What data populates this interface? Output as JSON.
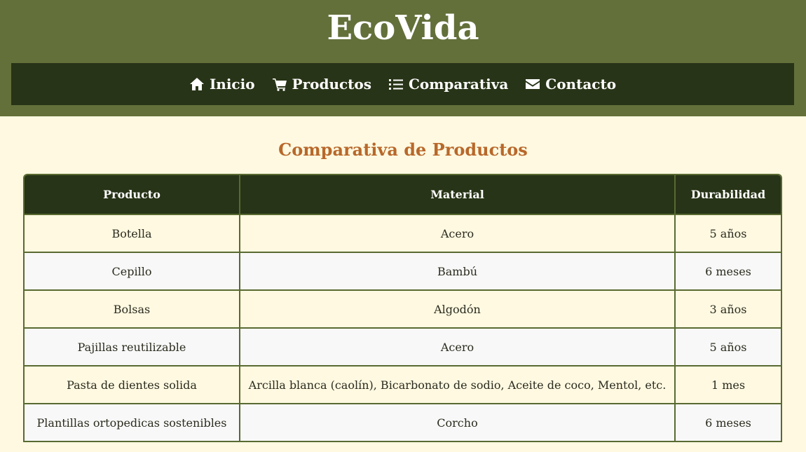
{
  "site": {
    "title": "EcoVida"
  },
  "nav": {
    "items": [
      {
        "label": "Inicio",
        "icon": "home-icon"
      },
      {
        "label": "Productos",
        "icon": "cart-icon"
      },
      {
        "label": "Comparativa",
        "icon": "list-icon"
      },
      {
        "label": "Contacto",
        "icon": "envelope-icon"
      }
    ]
  },
  "main": {
    "title": "Comparativa de Productos",
    "table": {
      "headers": [
        "Producto",
        "Material",
        "Durabilidad"
      ],
      "rows": [
        [
          "Botella",
          "Acero",
          "5 años"
        ],
        [
          "Cepillo",
          "Bambú",
          "6 meses"
        ],
        [
          "Bolsas",
          "Algodón",
          "3 años"
        ],
        [
          "Pajillas reutilizable",
          "Acero",
          "5 años"
        ],
        [
          "Pasta de dientes solida",
          "Arcilla blanca (caolín), Bicarbonato de sodio, Aceite de coco, Mentol, etc.",
          "1 mes"
        ],
        [
          "Plantillas ortopedicas sostenibles",
          "Corcho",
          "6 meses"
        ]
      ]
    }
  },
  "colors": {
    "header_bg": "#63703a",
    "nav_bg": "#283417",
    "page_bg": "#fff9e1",
    "accent_title": "#b8682a",
    "table_border": "#596a31",
    "row_alt": "#f8f8f8"
  }
}
